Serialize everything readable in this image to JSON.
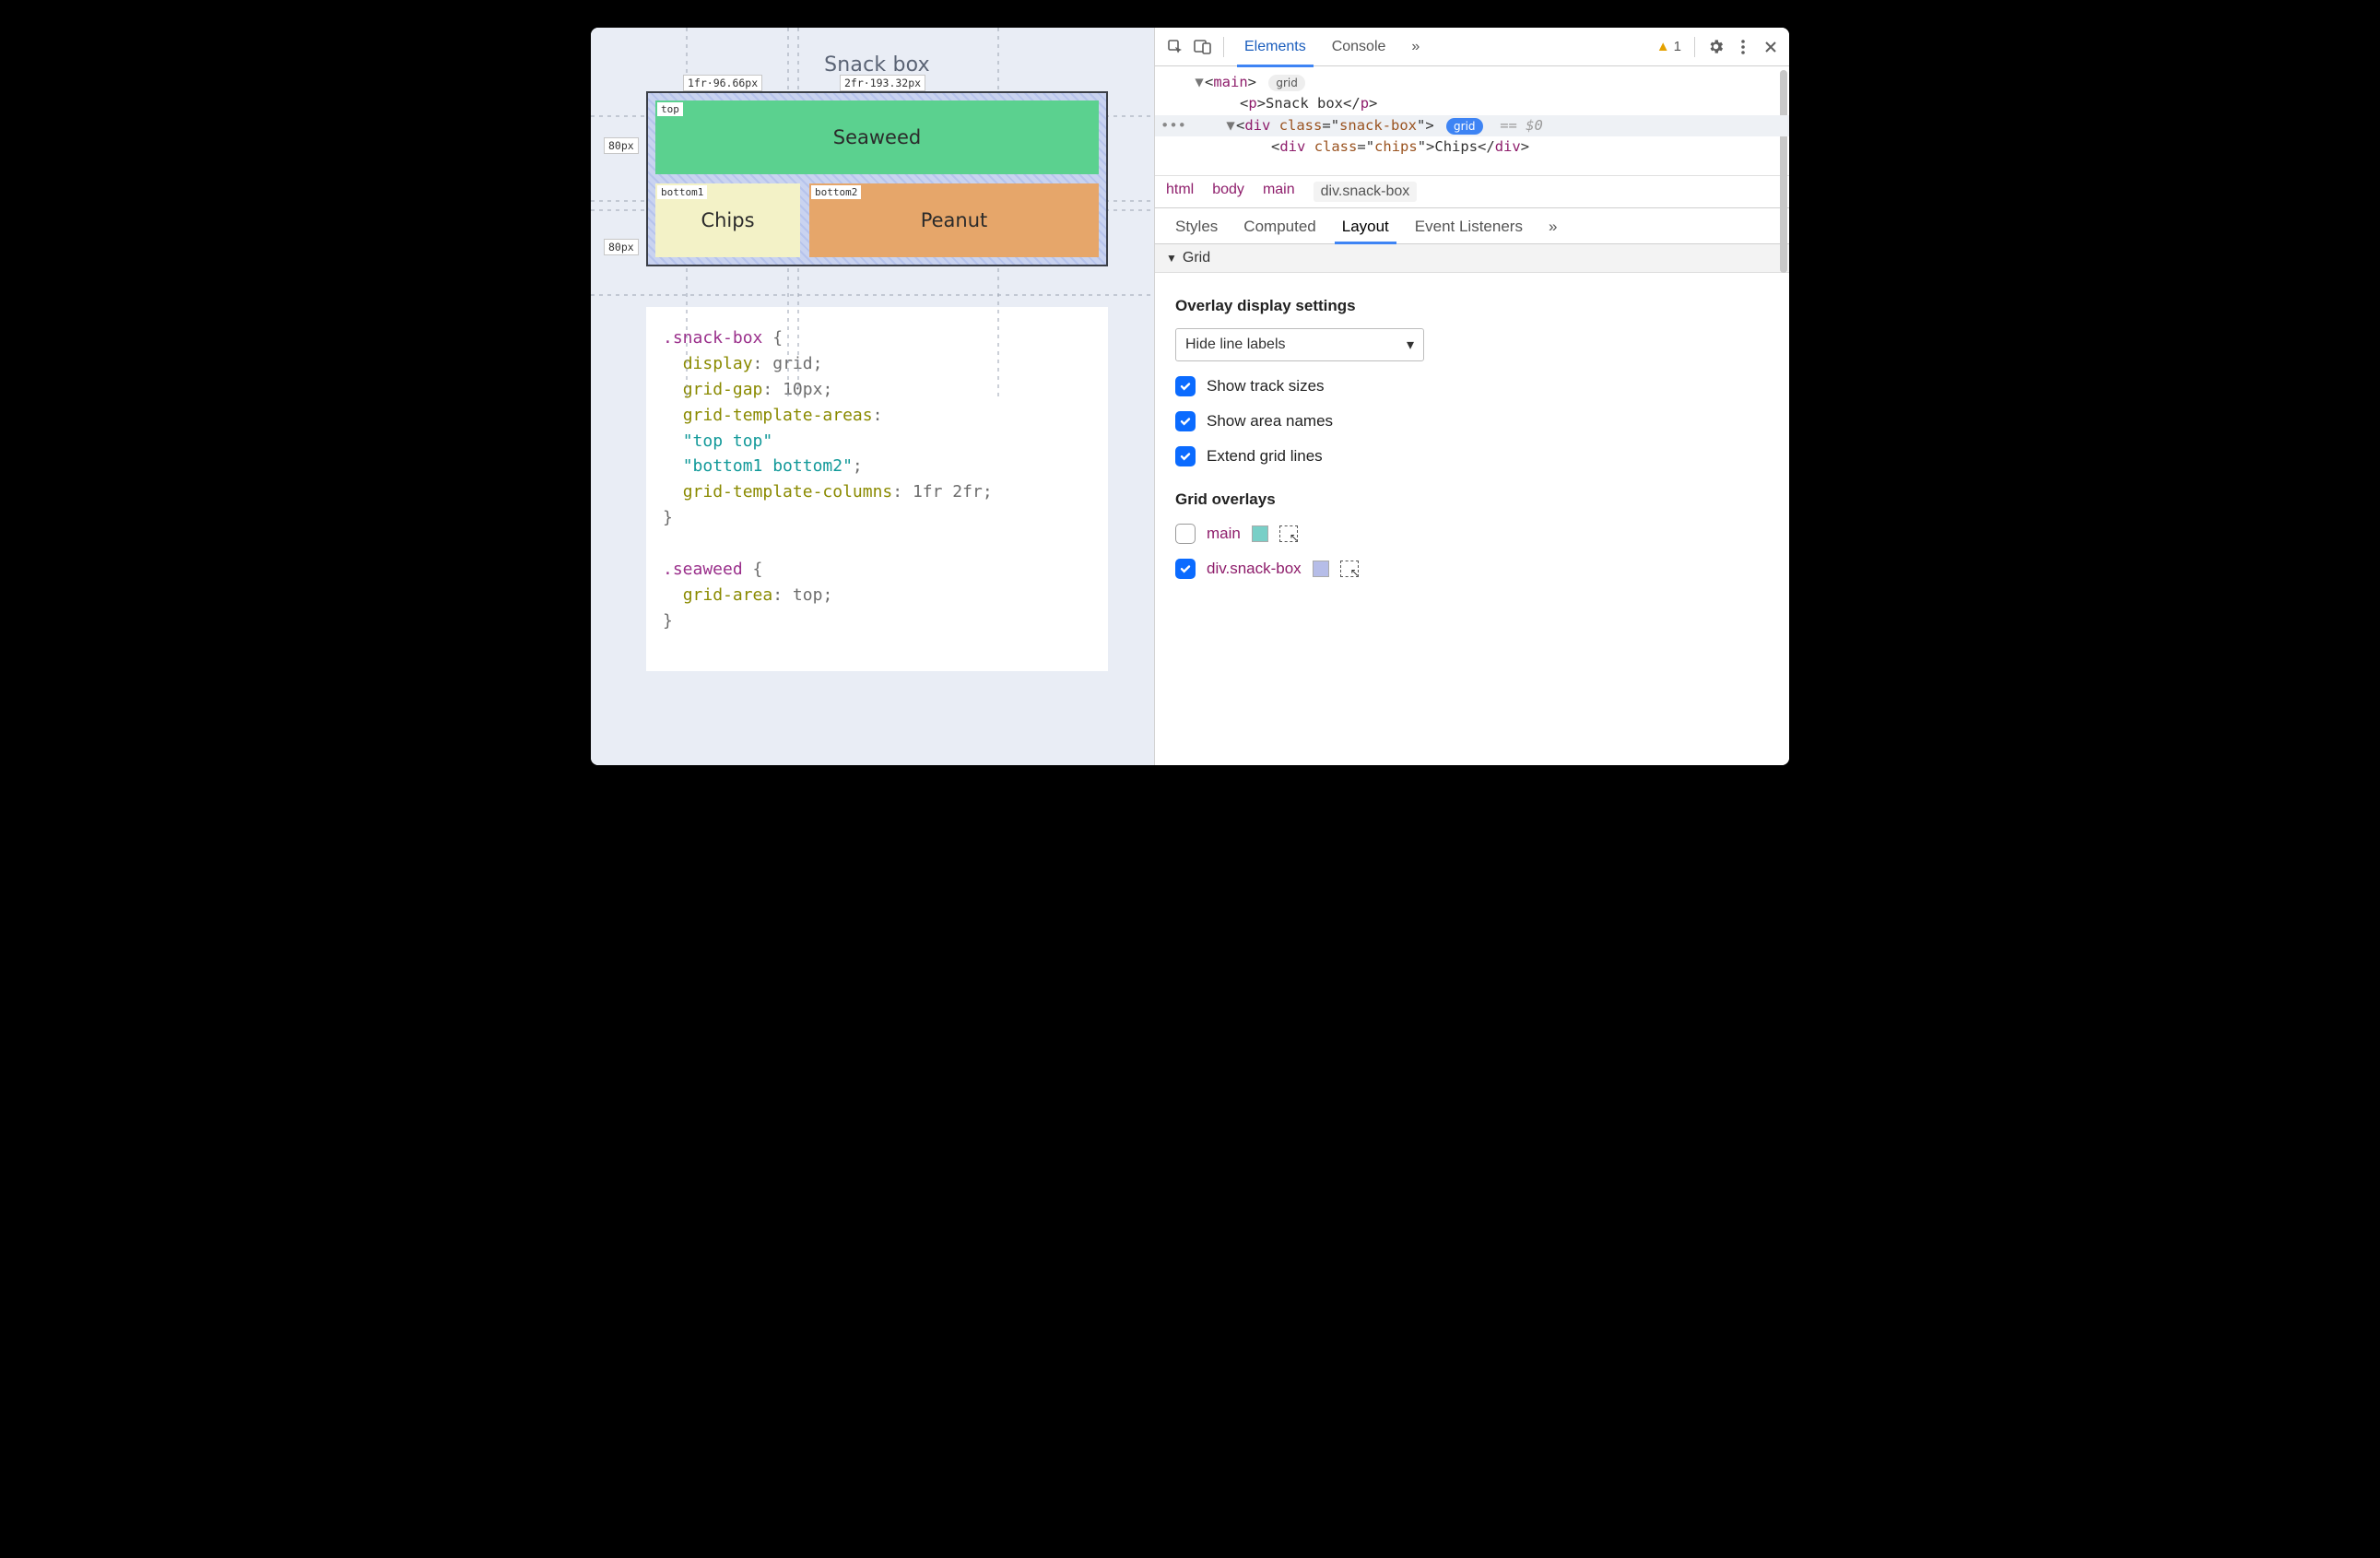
{
  "page": {
    "title": "Snack box",
    "grid": {
      "col_labels": [
        "1fr·96.66px",
        "2fr·193.32px"
      ],
      "row_labels": [
        "80px",
        "80px"
      ],
      "areas": {
        "top": {
          "tag": "top",
          "text": "Seaweed"
        },
        "bottom1": {
          "tag": "bottom1",
          "text": "Chips"
        },
        "bottom2": {
          "tag": "bottom2",
          "text": "Peanut"
        }
      }
    },
    "css": {
      "sel1": ".snack-box",
      "l1_prop": "display",
      "l1_val": "grid",
      "l2_prop": "grid-gap",
      "l2_val": "10px",
      "l3_prop": "grid-template-areas",
      "l3_val1": "\"top top\"",
      "l3_val2": "\"bottom1 bottom2\"",
      "l4_prop": "grid-template-columns",
      "l4_val": "1fr 2fr",
      "sel2": ".seaweed",
      "l5_prop": "grid-area",
      "l5_val": "top"
    }
  },
  "devtools": {
    "tabs": {
      "elements": "Elements",
      "console": "Console",
      "more": "»"
    },
    "warning_count": "1",
    "dom": {
      "line1_tag": "main",
      "line1_badge": "grid",
      "line2_tag": "p",
      "line2_text": "Snack box",
      "line3_tag": "div",
      "line3_class": "snack-box",
      "line3_badge": "grid",
      "line3_tail": "== $0",
      "line4_tag": "div",
      "line4_class": "chips",
      "line4_text": "Chips"
    },
    "crumbs": [
      "html",
      "body",
      "main",
      "div.snack-box"
    ],
    "subtabs": {
      "styles": "Styles",
      "computed": "Computed",
      "layout": "Layout",
      "listeners": "Event Listeners",
      "more": "»"
    },
    "section": "Grid",
    "overlay": {
      "heading": "Overlay display settings",
      "select_label": "Hide line labels",
      "cb1": "Show track sizes",
      "cb2": "Show area names",
      "cb3": "Extend grid lines"
    },
    "overlays": {
      "heading": "Grid overlays",
      "row1": {
        "name": "main",
        "color": "#79cfc7",
        "checked": false
      },
      "row2": {
        "name": "div.snack-box",
        "color": "#b6bde8",
        "checked": true
      }
    }
  }
}
